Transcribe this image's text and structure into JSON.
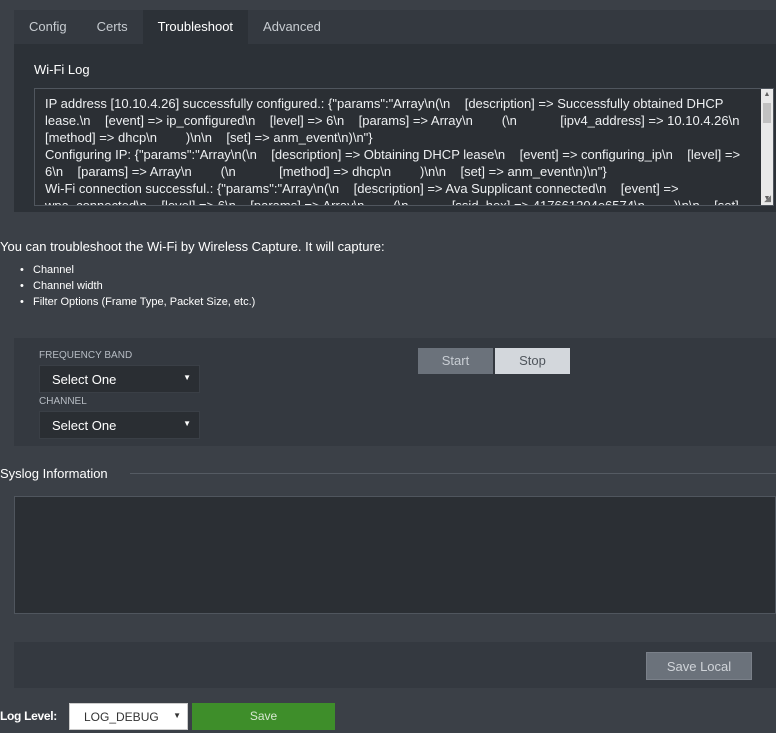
{
  "tabs": [
    {
      "label": "Config"
    },
    {
      "label": "Certs"
    },
    {
      "label": "Troubleshoot"
    },
    {
      "label": "Advanced"
    }
  ],
  "wifi_log": {
    "title": "Wi-Fi Log",
    "content": "IP address [10.10.4.26] successfully configured.: {\"params\":\"Array\\n(\\n    [description] => Successfully obtained DHCP lease.\\n    [event] => ip_configured\\n    [level] => 6\\n    [params] => Array\\n        (\\n            [ipv4_address] => 10.10.4.26\\n            [method] => dhcp\\n        )\\n\\n    [set] => anm_event\\n)\\n\"}\nConfiguring IP: {\"params\":\"Array\\n(\\n    [description] => Obtaining DHCP lease\\n    [event] => configuring_ip\\n    [level] => 6\\n    [params] => Array\\n        (\\n            [method] => dhcp\\n        )\\n\\n    [set] => anm_event\\n)\\n\"}\nWi-Fi connection successful.: {\"params\":\"Array\\n(\\n    [description] => Ava Supplicant connected\\n    [event] => wpa_connected\\n    [level] => 6\\n    [params] => Array\\n        (\\n            [ssid_hex] => 417661204e6574\\n        )\\n\\n    [set] => anm_event\\n)\\n\"}"
  },
  "capture": {
    "intro": "You can troubleshoot the Wi-Fi by Wireless Capture. It will capture:",
    "features": [
      "Channel",
      "Channel width",
      "Filter Options (Frame Type, Packet Size, etc.)"
    ],
    "frequency_band_label": "FREQUENCY BAND",
    "frequency_band_value": "Select One",
    "channel_label": "CHANNEL",
    "channel_value": "Select One",
    "start_label": "Start",
    "stop_label": "Stop"
  },
  "syslog": {
    "title": "Syslog Information",
    "content": ""
  },
  "save_local_label": "Save Local",
  "log_level": {
    "label": "Log Level:",
    "value": "LOG_DEBUG",
    "save_label": "Save"
  }
}
